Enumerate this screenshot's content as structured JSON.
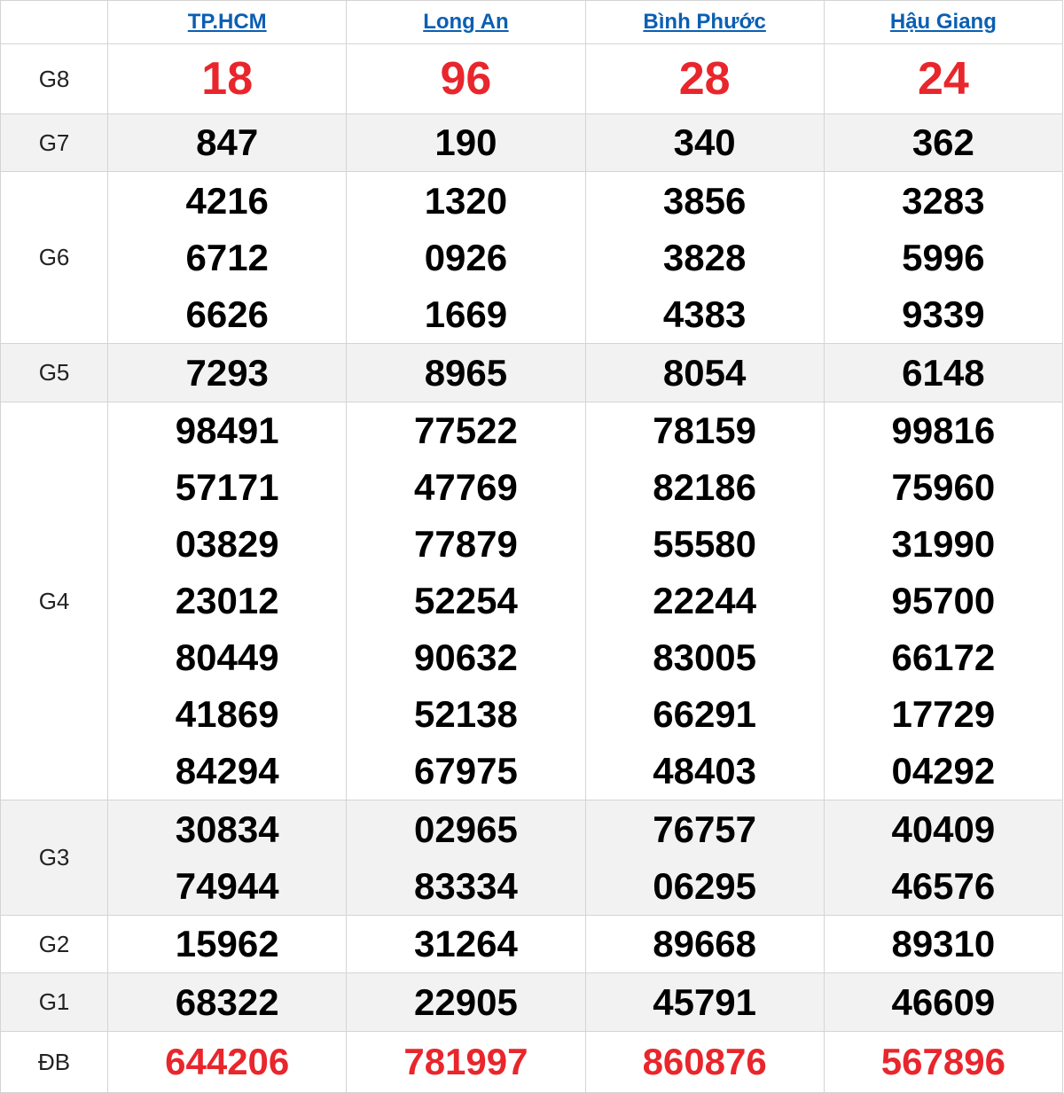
{
  "provinces": [
    "TP.HCM",
    "Long An",
    "Bình Phước",
    "Hậu Giang"
  ],
  "colors": {
    "red": "#e8262c",
    "link": "#0b5fb3",
    "shade": "#f2f2f2"
  },
  "prizes": [
    {
      "label": "G8",
      "numbers": [
        [
          "18"
        ],
        [
          "96"
        ],
        [
          "28"
        ],
        [
          "24"
        ]
      ]
    },
    {
      "label": "G7",
      "numbers": [
        [
          "847"
        ],
        [
          "190"
        ],
        [
          "340"
        ],
        [
          "362"
        ]
      ]
    },
    {
      "label": "G6",
      "numbers": [
        [
          "4216",
          "6712",
          "6626"
        ],
        [
          "1320",
          "0926",
          "1669"
        ],
        [
          "3856",
          "3828",
          "4383"
        ],
        [
          "3283",
          "5996",
          "9339"
        ]
      ]
    },
    {
      "label": "G5",
      "numbers": [
        [
          "7293"
        ],
        [
          "8965"
        ],
        [
          "8054"
        ],
        [
          "6148"
        ]
      ]
    },
    {
      "label": "G4",
      "numbers": [
        [
          "98491",
          "57171",
          "03829",
          "23012",
          "80449",
          "41869",
          "84294"
        ],
        [
          "77522",
          "47769",
          "77879",
          "52254",
          "90632",
          "52138",
          "67975"
        ],
        [
          "78159",
          "82186",
          "55580",
          "22244",
          "83005",
          "66291",
          "48403"
        ],
        [
          "99816",
          "75960",
          "31990",
          "95700",
          "66172",
          "17729",
          "04292"
        ]
      ]
    },
    {
      "label": "G3",
      "numbers": [
        [
          "30834",
          "74944"
        ],
        [
          "02965",
          "83334"
        ],
        [
          "76757",
          "06295"
        ],
        [
          "40409",
          "46576"
        ]
      ]
    },
    {
      "label": "G2",
      "numbers": [
        [
          "15962"
        ],
        [
          "31264"
        ],
        [
          "89668"
        ],
        [
          "89310"
        ]
      ]
    },
    {
      "label": "G1",
      "numbers": [
        [
          "68322"
        ],
        [
          "22905"
        ],
        [
          "45791"
        ],
        [
          "46609"
        ]
      ]
    },
    {
      "label": "ĐB",
      "numbers": [
        [
          "644206"
        ],
        [
          "781997"
        ],
        [
          "860876"
        ],
        [
          "567896"
        ]
      ]
    }
  ]
}
